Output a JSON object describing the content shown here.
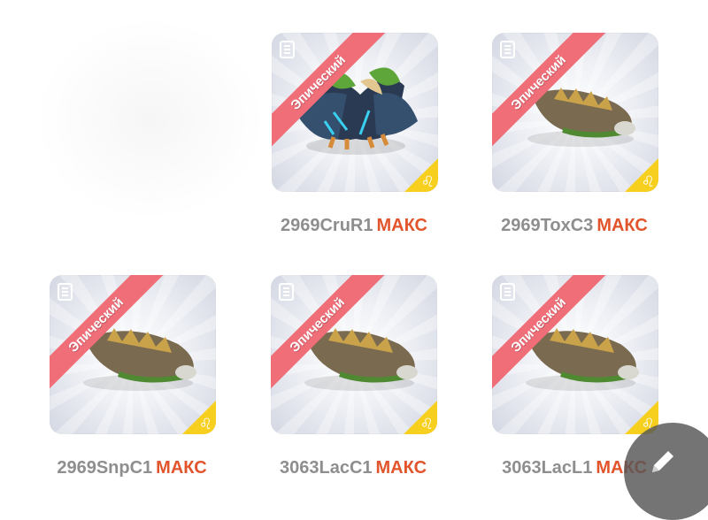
{
  "colors": {
    "rarity_ribbon": "#f06e78",
    "element_badge": "#f7cf1e",
    "max_label": "#e2552c",
    "code_label": "#8e8e8e"
  },
  "cards": [
    {
      "rarity": "Эпический",
      "code": "2969CruR1",
      "max": "МАКС",
      "element_icon": "leo-sign-icon",
      "creature": "dark-winged-dragon"
    },
    {
      "rarity": "Эпический",
      "code": "2969ToxC3",
      "max": "МАКС",
      "element_icon": "leo-sign-icon",
      "creature": "armored-lizard"
    },
    {
      "rarity": "Эпический",
      "code": "2969SnpC1",
      "max": "МАКС",
      "element_icon": "leo-sign-icon",
      "creature": "armored-lizard"
    },
    {
      "rarity": "Эпический",
      "code": "3063LacC1",
      "max": "МАКС",
      "element_icon": "leo-sign-icon",
      "creature": "armored-lizard"
    },
    {
      "rarity": "Эпический",
      "code": "3063LacL1",
      "max": "МАКС",
      "element_icon": "leo-sign-icon",
      "creature": "armored-lizard"
    }
  ],
  "fab": {
    "icon": "pencil-icon"
  }
}
